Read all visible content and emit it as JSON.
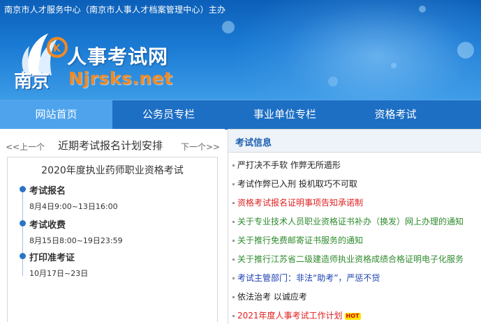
{
  "header": {
    "org_line": "南京市人才服务中心（南京市人事人才档案管理中心）主办",
    "site_name": "人事考试网",
    "city": "南京",
    "domain": "Njrsks.net"
  },
  "nav": {
    "items": [
      {
        "label": "网站首页",
        "active": true
      },
      {
        "label": "公务员专栏",
        "active": false
      },
      {
        "label": "事业单位专栏",
        "active": false
      },
      {
        "label": "资格考试",
        "active": false
      }
    ]
  },
  "plan": {
    "prev_label": "<<上一个",
    "title": "近期考试报名计划安排",
    "next_label": "下一个>>",
    "exam_title": "2020年度执业药师职业资格考试",
    "steps": [
      {
        "label": "考试报名",
        "date": "8月4日9:00~13日16:00"
      },
      {
        "label": "考试收费",
        "date": "8月15日8:00~19日23:59"
      },
      {
        "label": "打印准考证",
        "date": "10月17日~23日"
      }
    ]
  },
  "news": {
    "title": "考试信息",
    "items": [
      {
        "text": "严打决不手软 作弊无所遁形",
        "color": "#222222"
      },
      {
        "text": "考试作弊已入刑 投机取巧不可取",
        "color": "#222222"
      },
      {
        "text": "资格考试报名证明事项告知承诺制",
        "color": "#e02020"
      },
      {
        "text": "关于专业技术人员职业资格证书补办（换发）网上办理的通知",
        "color": "#2e8b2e"
      },
      {
        "text": "关于推行免费邮寄证书服务的通知",
        "color": "#2e8b2e"
      },
      {
        "text": "关于推行江苏省二级建造师执业资格成绩合格证明电子化服务",
        "color": "#2e8b2e"
      },
      {
        "text": "考试主管部门：非法“助考”，严惩不贷",
        "color": "#1a3fb0"
      },
      {
        "text": "依法治考 以诚应考",
        "color": "#222222"
      },
      {
        "text": "2021年度人事考试工作计划",
        "color": "#e02020",
        "badge": "HOT"
      }
    ]
  },
  "colors": {
    "header_blue": "#1a7ad3",
    "nav_blue": "#1d6fc4",
    "nav_active": "#4ea3ec",
    "domain_orange": "#f08a24"
  }
}
